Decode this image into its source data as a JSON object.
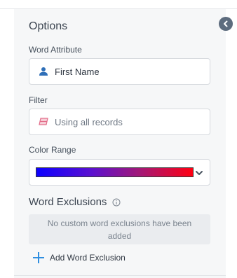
{
  "panel": {
    "title": "Options",
    "collapse_icon": "chevron-left-icon"
  },
  "word_attribute": {
    "label": "Word Attribute",
    "value": "First Name",
    "icon": "person-icon"
  },
  "filter": {
    "label": "Filter",
    "value": "Using all records",
    "icon": "eraser-icon"
  },
  "color_range": {
    "label": "Color Range",
    "gradient_start": "#0c00ff",
    "gradient_end": "#ff0012",
    "dropdown_icon": "chevron-down-icon"
  },
  "word_exclusions": {
    "title": "Word Exclusions",
    "info_icon": "info-icon",
    "empty_message": "No custom word exclusions have been added",
    "add_label": "Add Word Exclusion",
    "add_icon": "plus-icon"
  },
  "colors": {
    "accent": "#2f8ee0",
    "panel_bg": "#f6f7f8"
  }
}
